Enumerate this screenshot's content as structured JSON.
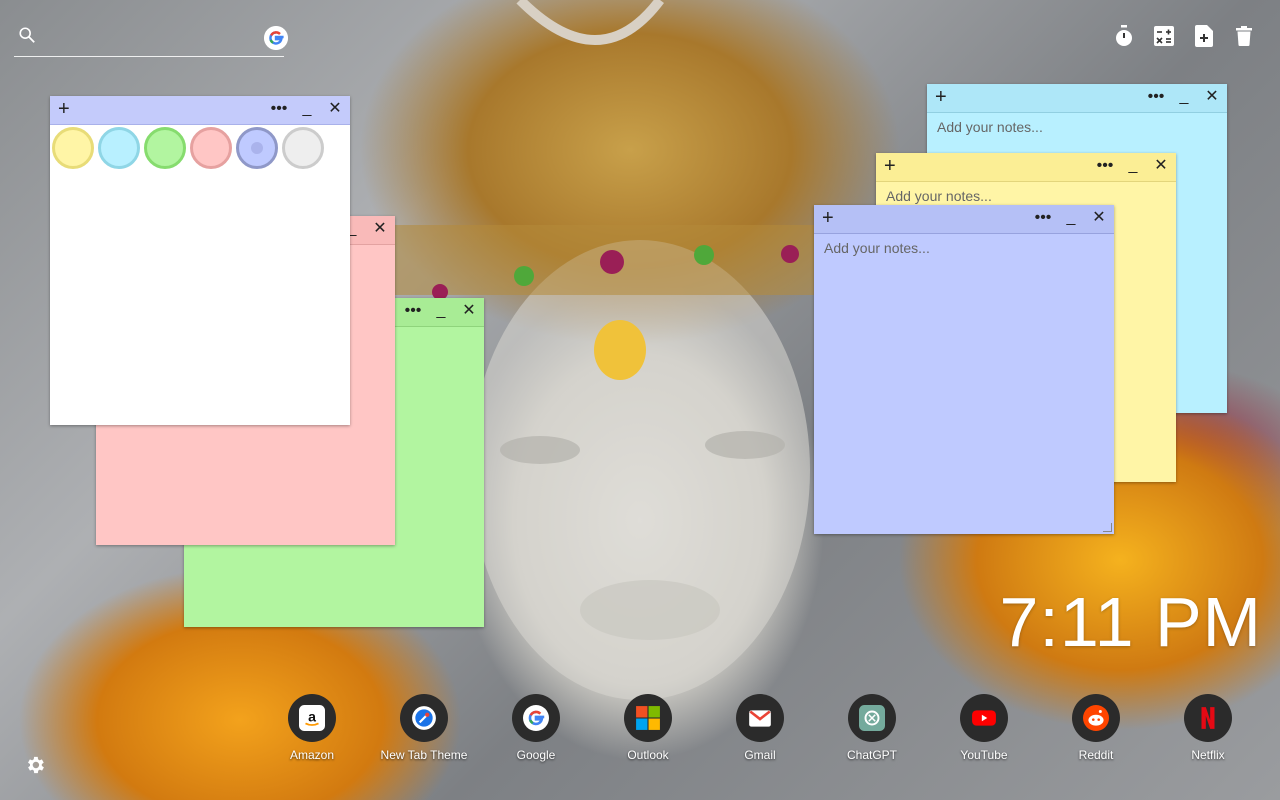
{
  "search": {
    "placeholder": "",
    "icon": "search-icon",
    "engine_icon": "google-icon"
  },
  "toolbar": {
    "items": [
      "timer-icon",
      "calculator-icon",
      "add-note-icon",
      "trash-icon"
    ]
  },
  "notes": {
    "placeholder": "Add your notes...",
    "plus": "+",
    "more": "•••",
    "minimize": "_",
    "close": "✕",
    "colors": {
      "yellow": "#fff5a6",
      "cyan": "#b8f0ff",
      "green": "#b2f5a0",
      "pink": "#ffc6c5",
      "blue": "#bfcaff",
      "white": "#ffffff"
    }
  },
  "palette": [
    {
      "name": "yellow",
      "fill": "#fff5a6",
      "ring": "#e8dc78"
    },
    {
      "name": "cyan",
      "fill": "#b8f0ff",
      "ring": "#8fd6e6"
    },
    {
      "name": "green",
      "fill": "#b2f5a0",
      "ring": "#86dc6e"
    },
    {
      "name": "pink",
      "fill": "#ffc6c5",
      "ring": "#e6a1a0"
    },
    {
      "name": "blue",
      "fill": "#bfcaff",
      "ring": "#8f98c8",
      "selected": true
    },
    {
      "name": "white",
      "fill": "#eeeeee",
      "ring": "#cccccc"
    }
  ],
  "clock": {
    "time": "7:11 PM"
  },
  "shortcuts": [
    {
      "label": "Amazon",
      "icon": "amazon-icon"
    },
    {
      "label": "New Tab Theme",
      "icon": "new-tab-theme-icon"
    },
    {
      "label": "Google",
      "icon": "google-icon"
    },
    {
      "label": "Outlook",
      "icon": "outlook-icon"
    },
    {
      "label": "Gmail",
      "icon": "gmail-icon"
    },
    {
      "label": "ChatGPT",
      "icon": "chatgpt-icon"
    },
    {
      "label": "YouTube",
      "icon": "youtube-icon"
    },
    {
      "label": "Reddit",
      "icon": "reddit-icon"
    },
    {
      "label": "Netflix",
      "icon": "netflix-icon"
    }
  ],
  "settings": {
    "icon": "gear-icon"
  }
}
